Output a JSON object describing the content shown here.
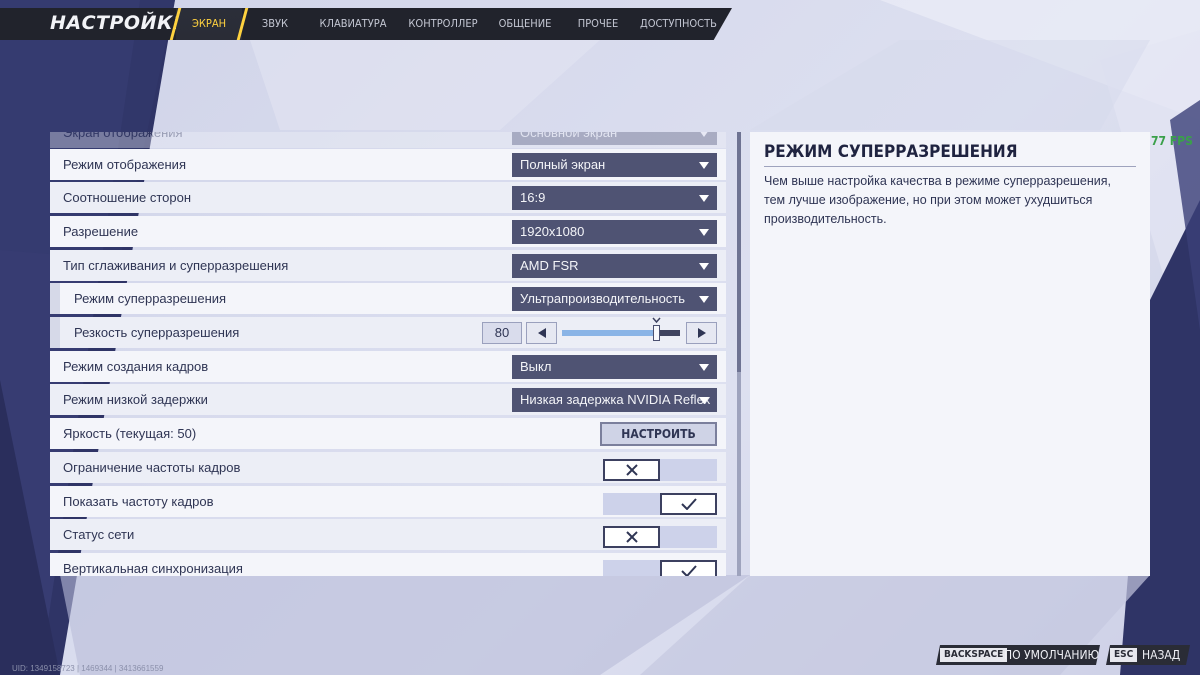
{
  "header": {
    "title": "НАСТРОЙКИ",
    "tabs": [
      {
        "label": "ЭКРАН",
        "active": true
      },
      {
        "label": "ЗВУК",
        "active": false
      },
      {
        "label": "КЛАВИАТУРА",
        "active": false
      },
      {
        "label": "КОНТРОЛЛЕР",
        "active": false
      },
      {
        "label": "ОБЩЕНИЕ",
        "active": false
      },
      {
        "label": "ПРОЧЕЕ",
        "active": false
      },
      {
        "label": "ДОСТУПНОСТЬ",
        "active": false
      }
    ]
  },
  "settings": {
    "rows": [
      {
        "label": "Экран отображения",
        "type": "dropdown",
        "value": "Основной экран",
        "faded": true
      },
      {
        "label": "Режим отображения",
        "type": "dropdown",
        "value": "Полный экран"
      },
      {
        "label": "Соотношение сторон",
        "type": "dropdown",
        "value": "16:9"
      },
      {
        "label": "Разрешение",
        "type": "dropdown",
        "value": "1920x1080"
      },
      {
        "label": "Тип сглаживания и суперразрешения",
        "type": "dropdown",
        "value": "AMD FSR"
      },
      {
        "label": "Режим суперразрешения",
        "type": "dropdown",
        "value": "Ультрапроизводительность",
        "sub": true
      },
      {
        "label": "Резкость суперразрешения",
        "type": "slider",
        "value": "80",
        "level": 0.8,
        "sub": true
      },
      {
        "label": "Режим создания кадров",
        "type": "dropdown",
        "value": "Выкл"
      },
      {
        "label": "Режим низкой задержки",
        "type": "dropdown",
        "value": "Низкая задержка NVIDIA Reflex"
      },
      {
        "label": "Яркость (текущая: 50)",
        "type": "button",
        "value": "НАСТРОИТЬ"
      },
      {
        "label": "Ограничение частоты кадров",
        "type": "toggle",
        "on": false
      },
      {
        "label": "Показать частоту кадров",
        "type": "toggle",
        "on": true
      },
      {
        "label": "Статус сети",
        "type": "toggle",
        "on": false
      },
      {
        "label": "Вертикальная синхронизация",
        "type": "toggle",
        "on": true
      }
    ]
  },
  "description": {
    "title": "РЕЖИМ СУПЕРРАЗРЕШЕНИЯ",
    "body": "Чем выше настройка качества в режиме суперразрешения, тем лучше изображение, но при этом может ухудшиться производительность."
  },
  "overlay": {
    "fps": "77 FPS",
    "uid": "UID: 1349158723 | 1469344 | 3413661559"
  },
  "footer": {
    "reset_key": "BACKSPACE",
    "reset_label": "ПО УМОЛЧАНИЮ",
    "back_key": "ESC",
    "back_label": "НАЗАД"
  },
  "colors": {
    "accent": "#ffd23f",
    "nav_bg": "#21232c",
    "dropdown_bg": "#4f5373",
    "fps_green": "#3aa04a"
  }
}
